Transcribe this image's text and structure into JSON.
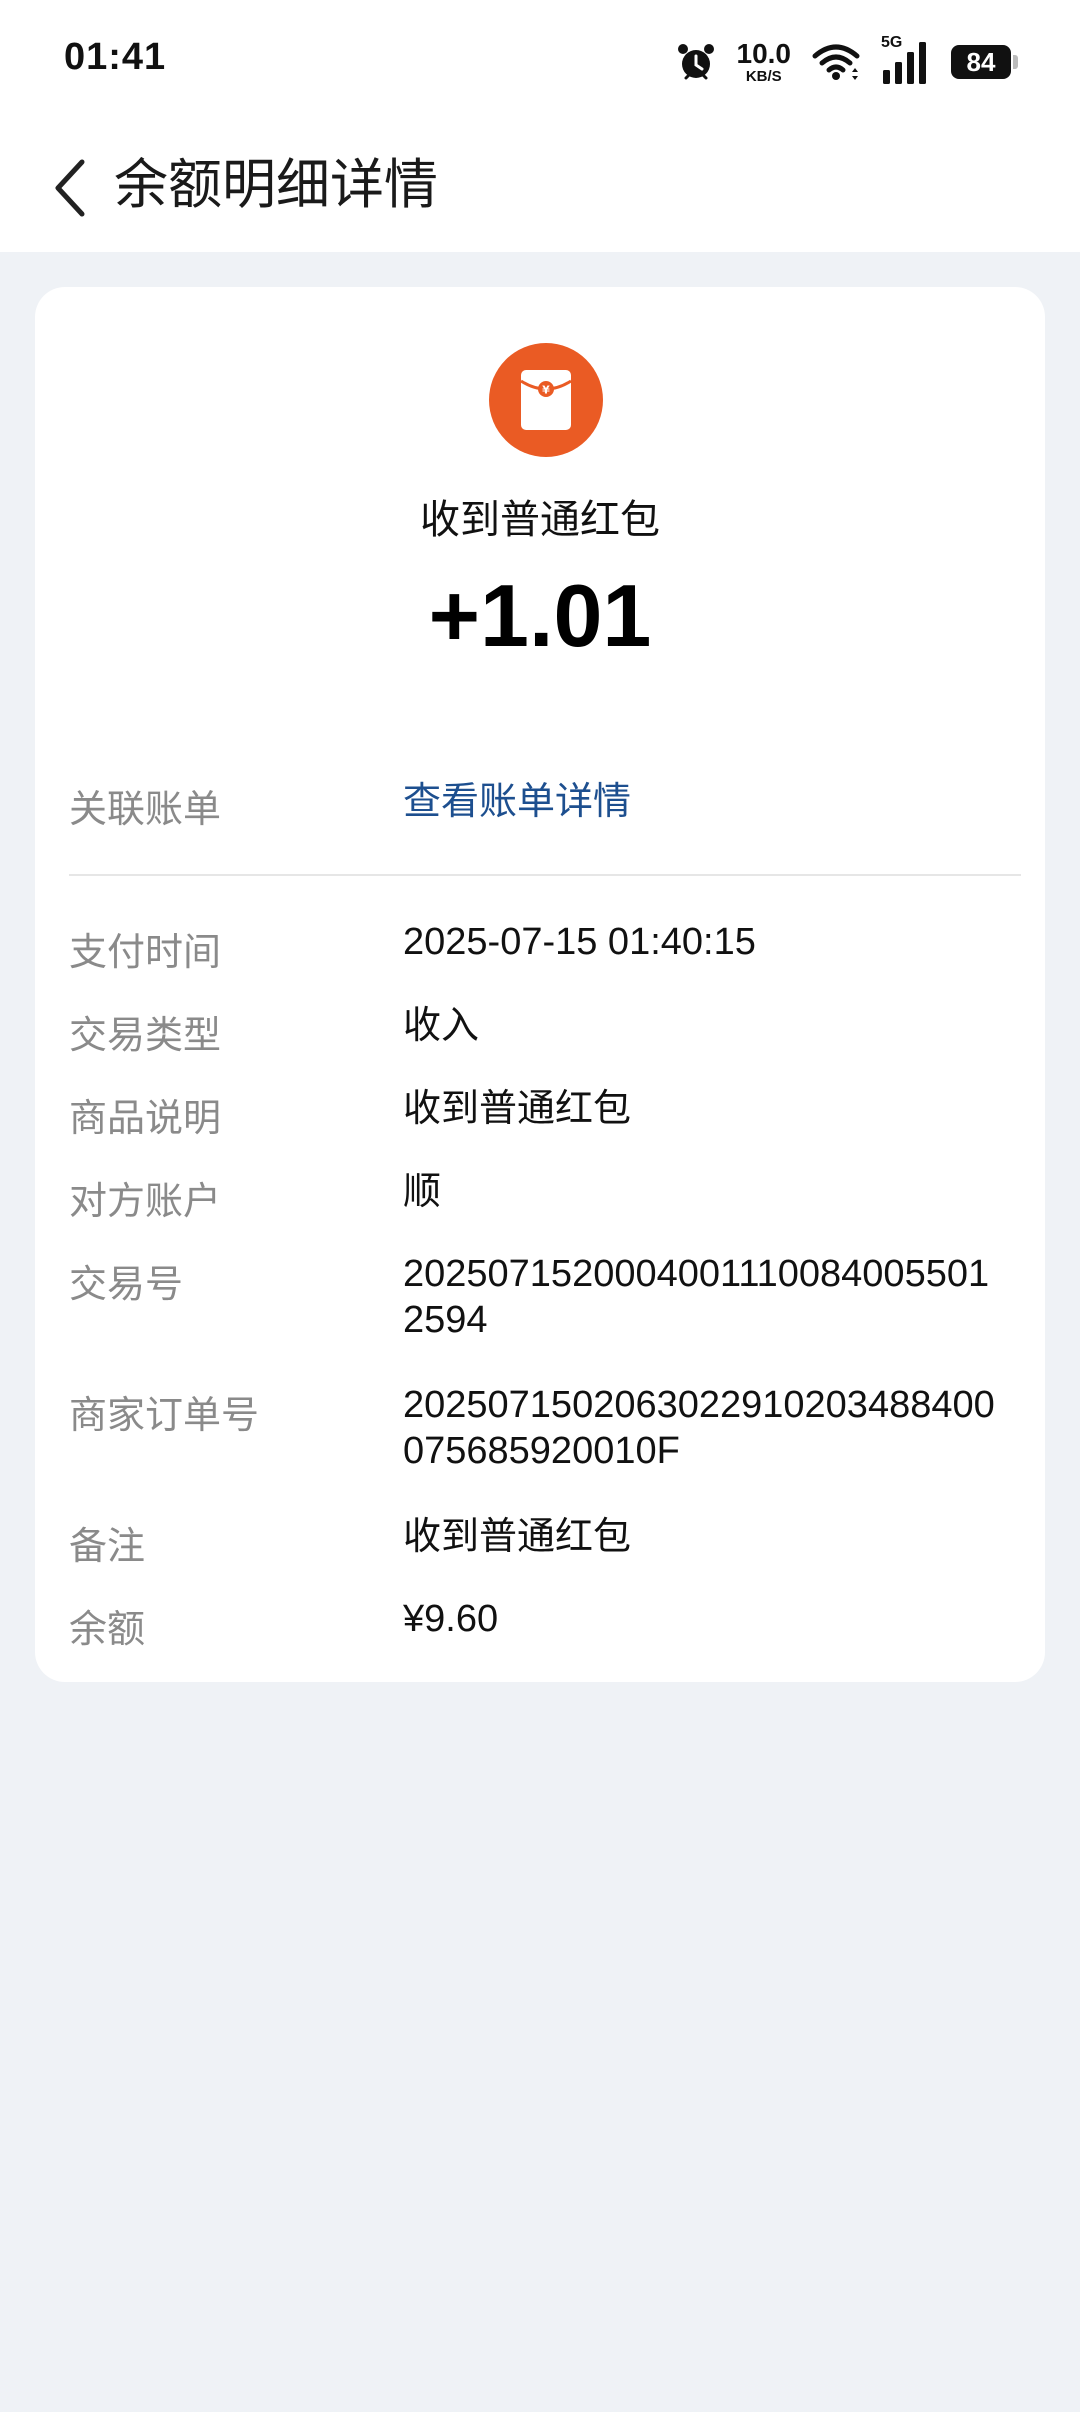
{
  "status_bar": {
    "time": "01:41",
    "net_speed_value": "10.0",
    "net_speed_unit": "KB/S",
    "network_type": "5G",
    "battery": "84"
  },
  "nav": {
    "title": "余额明细详情"
  },
  "summary": {
    "icon": "red-packet-icon",
    "title": "收到普通红包",
    "amount": "+1.01",
    "accent_color": "#ea5b24"
  },
  "linked_bill": {
    "label": "关联账单",
    "link_text": "查看账单详情",
    "link_color": "#1d4f8f"
  },
  "details": [
    {
      "label": "支付时间",
      "value": "2025-07-15 01:40:15"
    },
    {
      "label": "交易类型",
      "value": "收入"
    },
    {
      "label": "商品说明",
      "value": "收到普通红包"
    },
    {
      "label": "对方账户",
      "value": "顺"
    },
    {
      "label": "交易号",
      "value": "2025071520004001110084005501 2594"
    },
    {
      "label": "商家订单号",
      "value": "2025071502063022910203488400075685920010F"
    },
    {
      "label": "备注",
      "value": "收到普通红包"
    },
    {
      "label": "余额",
      "value": "¥9.60"
    }
  ]
}
